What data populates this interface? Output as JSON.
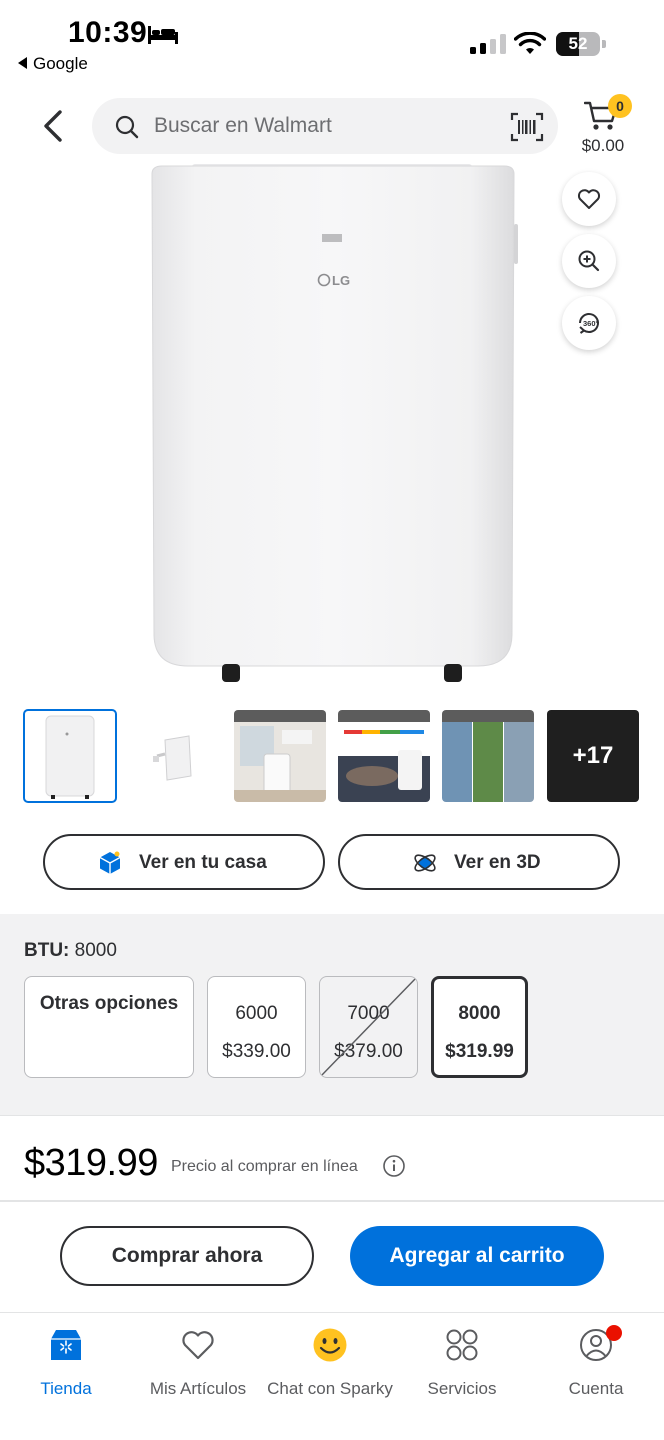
{
  "status_bar": {
    "time": "10:39",
    "back_app": "Google",
    "battery_percent": 52,
    "battery_text": "52"
  },
  "header": {
    "search_placeholder": "Buscar en Walmart",
    "cart_count": "0",
    "cart_total": "$0.00"
  },
  "hero": {
    "brand_logo_text": "LG"
  },
  "thumbnails": {
    "more_label": "+17",
    "items": [
      {
        "kind": "front-view",
        "selected": true
      },
      {
        "kind": "side-view",
        "selected": false
      },
      {
        "kind": "easy-installation",
        "selected": false
      },
      {
        "kind": "quiet-operation",
        "selected": false
      },
      {
        "kind": "3-in-1-operation",
        "selected": false
      }
    ]
  },
  "view_buttons": {
    "home_label": "Ver en tu casa",
    "three_d_label": "Ver en 3D"
  },
  "options": {
    "btu_key": "BTU:",
    "btu_value": "8000",
    "other_options_label": "Otras opciones",
    "cards": [
      {
        "btu": "6000",
        "price": "$339.00",
        "available": true,
        "selected": false
      },
      {
        "btu": "7000",
        "price": "$379.00",
        "available": false,
        "selected": false
      },
      {
        "btu": "8000",
        "price": "$319.99",
        "available": true,
        "selected": true
      }
    ]
  },
  "price": {
    "amount": "$319.99",
    "note": "Precio al comprar en línea"
  },
  "actions": {
    "buy_now": "Comprar ahora",
    "add_to_cart": "Agregar al carrito"
  },
  "bottom_nav": [
    {
      "label": "Tienda",
      "icon": "store-icon",
      "active": true
    },
    {
      "label": "Mis Artículos",
      "icon": "heart-icon",
      "active": false
    },
    {
      "label": "Chat con Sparky",
      "icon": "sparky-icon",
      "active": false
    },
    {
      "label": "Servicios",
      "icon": "services-icon",
      "active": false
    },
    {
      "label": "Cuenta",
      "icon": "account-icon",
      "active": false
    }
  ],
  "colors": {
    "primary_blue": "#0071dc",
    "badge_yellow": "#ffc220",
    "notification_red": "#ea1100",
    "text_dark": "#2e2f32"
  }
}
